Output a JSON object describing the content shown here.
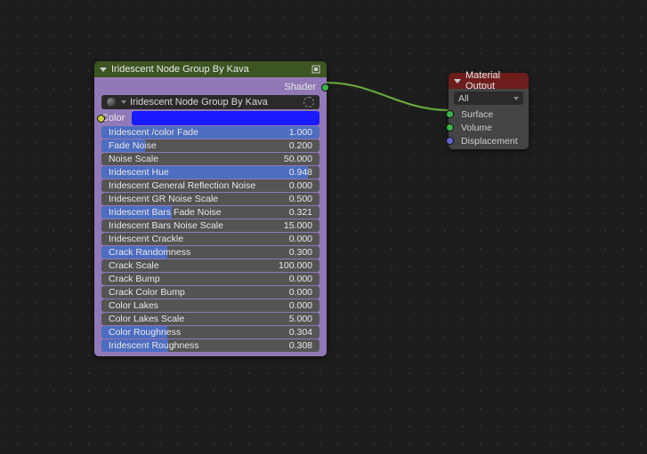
{
  "nodeMain": {
    "title": "Iridescent Node Group By Kava",
    "outputLabel": "Shader",
    "typeField": "Iridescent Node Group By Kava",
    "colorLabel": "Color",
    "sliders": [
      {
        "label": "Iridescent /color Fade",
        "value": "1.000",
        "fill": 100
      },
      {
        "label": "Fade Noise",
        "value": "0.200",
        "fill": 20
      },
      {
        "label": "Noise Scale",
        "value": "50.000",
        "fill": 0
      },
      {
        "label": "Iridescent Hue",
        "value": "0.948",
        "fill": 94.8
      },
      {
        "label": "Iridescent General Reflection Noise",
        "value": "0.000",
        "fill": 0
      },
      {
        "label": "Iridescent GR Noise Scale",
        "value": "0.500",
        "fill": 0
      },
      {
        "label": "Iridescent Bars Fade Noise",
        "value": "0.321",
        "fill": 32.1
      },
      {
        "label": "Iridescent Bars Noise Scale",
        "value": "15.000",
        "fill": 0
      },
      {
        "label": "Iridescent Crackle",
        "value": "0.000",
        "fill": 0
      },
      {
        "label": "Crack Randomness",
        "value": "0.300",
        "fill": 30
      },
      {
        "label": "Crack Scale",
        "value": "100.000",
        "fill": 0
      },
      {
        "label": "Crack Bump",
        "value": "0.000",
        "fill": 0
      },
      {
        "label": "Crack Color Bump",
        "value": "0.000",
        "fill": 0
      },
      {
        "label": "Color Lakes",
        "value": "0.000",
        "fill": 0
      },
      {
        "label": "Color Lakes Scale",
        "value": "5.000",
        "fill": 0
      },
      {
        "label": "Color Roughness",
        "value": "0.304",
        "fill": 30.4
      },
      {
        "label": "Iridescent Roughness",
        "value": "0.308",
        "fill": 30.8
      }
    ]
  },
  "nodeOutput": {
    "title": "Material Output",
    "target": "All",
    "inputs": [
      {
        "label": "Surface",
        "socket": "green"
      },
      {
        "label": "Volume",
        "socket": "green"
      },
      {
        "label": "Displacement",
        "socket": "blue"
      }
    ]
  }
}
